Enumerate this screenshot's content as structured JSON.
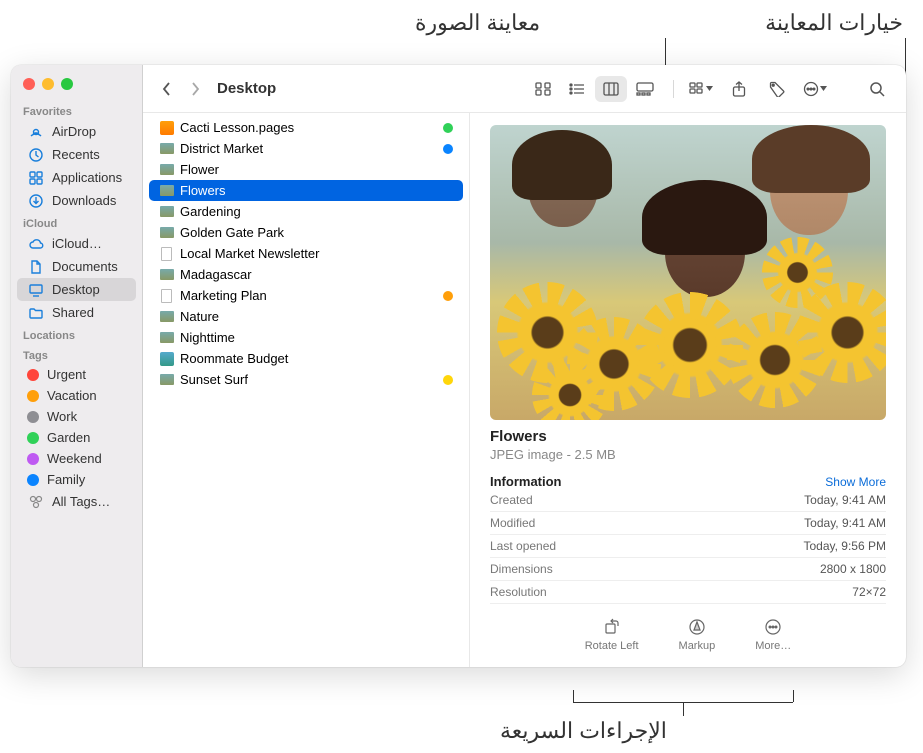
{
  "callouts": {
    "preview_options": "خيارات المعاينة",
    "image_preview": "معاينة الصورة",
    "quick_actions": "الإجراءات السريعة"
  },
  "window": {
    "title": "Desktop"
  },
  "sidebar": {
    "sections": {
      "favorites": "Favorites",
      "icloud": "iCloud",
      "locations": "Locations",
      "tags": "Tags"
    },
    "favorites": [
      {
        "label": "AirDrop",
        "icon": "airdrop"
      },
      {
        "label": "Recents",
        "icon": "clock"
      },
      {
        "label": "Applications",
        "icon": "apps"
      },
      {
        "label": "Downloads",
        "icon": "download"
      }
    ],
    "icloud": [
      {
        "label": "iCloud…",
        "icon": "cloud"
      },
      {
        "label": "Documents",
        "icon": "doc"
      },
      {
        "label": "Desktop",
        "icon": "desktop",
        "active": true
      },
      {
        "label": "Shared",
        "icon": "folder"
      }
    ],
    "tags": [
      {
        "label": "Urgent",
        "color": "#ff453a"
      },
      {
        "label": "Vacation",
        "color": "#ff9f0a"
      },
      {
        "label": "Work",
        "color": "#8e8e93"
      },
      {
        "label": "Garden",
        "color": "#30d158"
      },
      {
        "label": "Weekend",
        "color": "#bf5af2"
      },
      {
        "label": "Family",
        "color": "#0a84ff"
      }
    ],
    "all_tags": "All Tags…"
  },
  "files": [
    {
      "name": "Cacti Lesson.pages",
      "tag": "#30d158",
      "kind": "pages"
    },
    {
      "name": "District Market",
      "tag": "#0a84ff",
      "kind": "img"
    },
    {
      "name": "Flower",
      "kind": "img"
    },
    {
      "name": "Flowers",
      "kind": "img",
      "selected": true
    },
    {
      "name": "Gardening",
      "kind": "img"
    },
    {
      "name": "Golden Gate Park",
      "kind": "img"
    },
    {
      "name": "Local Market Newsletter",
      "kind": "doc"
    },
    {
      "name": "Madagascar",
      "kind": "img"
    },
    {
      "name": "Marketing Plan",
      "tag": "#ff9f0a",
      "kind": "doc"
    },
    {
      "name": "Nature",
      "kind": "img"
    },
    {
      "name": "Nighttime",
      "kind": "img"
    },
    {
      "name": "Roommate Budget",
      "kind": "sheet"
    },
    {
      "name": "Sunset Surf",
      "tag": "#ffd60a",
      "kind": "img"
    }
  ],
  "preview": {
    "name": "Flowers",
    "kind": "JPEG image - 2.5 MB",
    "info_label": "Information",
    "show_more": "Show More",
    "rows": [
      {
        "label": "Created",
        "value": "Today, 9:41 AM"
      },
      {
        "label": "Modified",
        "value": "Today, 9:41 AM"
      },
      {
        "label": "Last opened",
        "value": "Today, 9:56 PM"
      },
      {
        "label": "Dimensions",
        "value": "2800 x 1800"
      },
      {
        "label": "Resolution",
        "value": "72×72"
      }
    ],
    "actions": {
      "rotate": "Rotate Left",
      "markup": "Markup",
      "more": "More…"
    }
  }
}
